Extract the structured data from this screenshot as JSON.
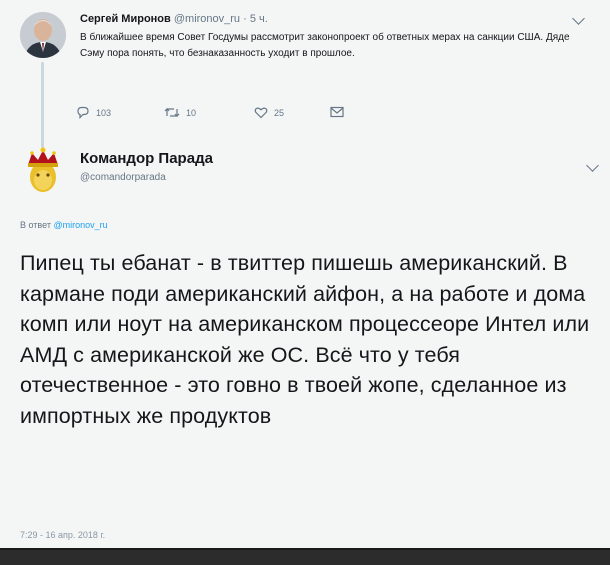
{
  "tweet1": {
    "author_name": "Сергей Миронов",
    "author_handle": "@mironov_ru",
    "dot": "·",
    "time": "5 ч.",
    "text": "В ближайшее время Совет Госдумы рассмотрит законопроект об ответных мерах на санкции США. Дяде Сэму пора понять, что безнаказанность уходит в прошлое.",
    "actions": {
      "reply_count": "103",
      "retweet_count": "10",
      "like_count": "25"
    }
  },
  "tweet2": {
    "author_name": "Командор Парада",
    "author_handle": "@comandorparada",
    "reply_to_label": "В ответ",
    "reply_to_mention": "@mironov_ru",
    "text": "Пипец ты ебанат - в твиттер пишешь американский. В кармане поди американский айфон, а на работе и дома комп или ноут на американском процессеоре Интел или АМД с американской же ОС. Всё что у тебя отечественное - это говно в твоей жопе, сделанное из импортных же продуктов",
    "timestamp": "7:29 - 16 апр. 2018 г."
  },
  "icons": {
    "reply": "reply-icon",
    "retweet": "retweet-icon",
    "like": "heart-icon",
    "dm": "envelope-icon",
    "menu": "chevron-down-icon",
    "avatar2_crown": "crown-icon"
  },
  "colors": {
    "link": "#1da1f2",
    "muted": "#657786",
    "background": "#f4f5f5"
  }
}
